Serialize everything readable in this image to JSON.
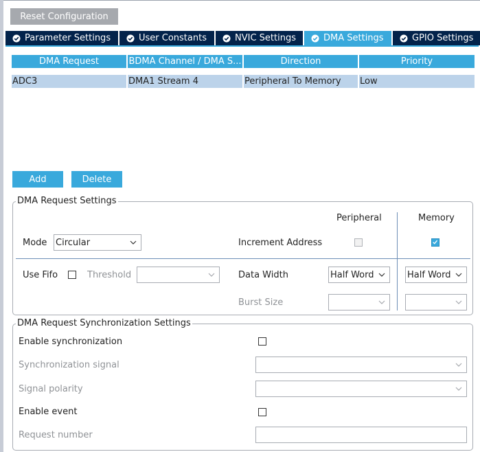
{
  "reset_button": "Reset Configuration",
  "tabs": [
    {
      "label": "Parameter Settings",
      "active": false
    },
    {
      "label": "User Constants",
      "active": false
    },
    {
      "label": "NVIC Settings",
      "active": false
    },
    {
      "label": "DMA Settings",
      "active": true
    },
    {
      "label": "GPIO Settings",
      "active": false
    }
  ],
  "dma_table": {
    "headers": [
      "DMA Request",
      "BDMA Channel / DMA S...",
      "Direction",
      "Priority"
    ],
    "rows": [
      [
        "ADC3",
        "DMA1 Stream 4",
        "Peripheral To Memory",
        "Low"
      ]
    ]
  },
  "buttons": {
    "add": "Add",
    "delete": "Delete"
  },
  "request_settings": {
    "title": "DMA Request Settings",
    "peripheral_header": "Peripheral",
    "memory_header": "Memory",
    "mode_label": "Mode",
    "mode_value": "Circular",
    "increment_address_label": "Increment Address",
    "peripheral_increment": false,
    "memory_increment": true,
    "use_fifo_label": "Use Fifo",
    "use_fifo": false,
    "threshold_label": "Threshold",
    "threshold_value": "",
    "data_width_label": "Data Width",
    "peripheral_data_width": "Half Word",
    "memory_data_width": "Half Word",
    "burst_size_label": "Burst Size",
    "peripheral_burst": "",
    "memory_burst": ""
  },
  "sync_settings": {
    "title": "DMA Request Synchronization Settings",
    "enable_sync_label": "Enable synchronization",
    "enable_sync": false,
    "sync_signal_label": "Synchronization signal",
    "sync_signal_value": "",
    "signal_polarity_label": "Signal polarity",
    "signal_polarity_value": "",
    "enable_event_label": "Enable event",
    "enable_event": false,
    "request_number_label": "Request number",
    "request_number_value": ""
  },
  "colors": {
    "accent": "#39a9dc",
    "tab_dark": "#03234b",
    "row_selected": "#bcd3ea",
    "reset_button": "#a6a9ae"
  }
}
